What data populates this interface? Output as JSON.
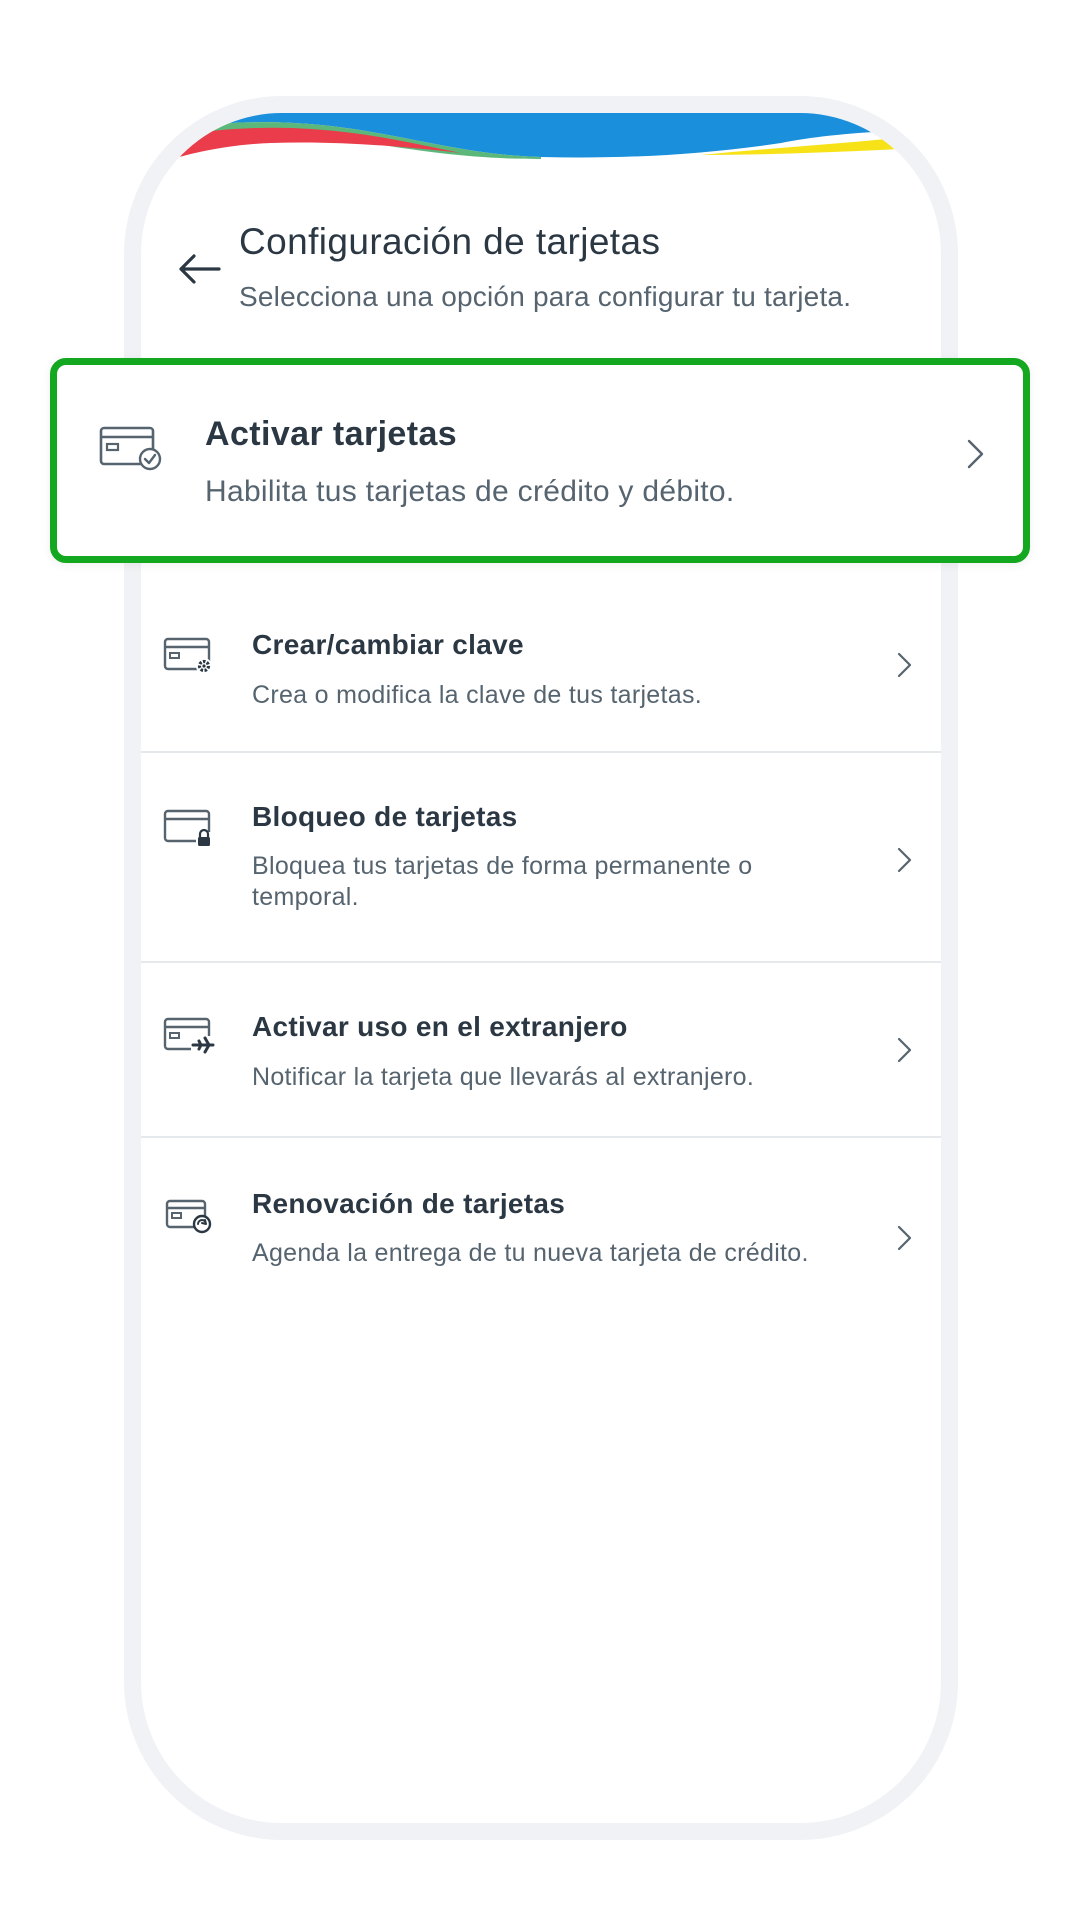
{
  "header": {
    "title": "Configuración de tarjetas",
    "subtitle": "Selecciona una opción para configurar tu tarjeta.",
    "back_icon": "arrow-left-icon"
  },
  "highlighted_option": {
    "label": "Activar tarjetas",
    "description": "Habilita tus tarjetas de crédito y débito.",
    "icon": "card-check-icon",
    "highlight_color": "#13a81f"
  },
  "options": [
    {
      "label": "Crear/cambiar clave",
      "description": "Crea o modifica la clave de tus tarjetas.",
      "icon": "card-gear-icon"
    },
    {
      "label": "Bloqueo de tarjetas",
      "description": "Bloquea tus tarjetas de forma permanente o temporal.",
      "icon": "card-lock-icon"
    },
    {
      "label": "Activar uso en el extranjero",
      "description": "Notificar la tarjeta que llevarás al extranjero.",
      "icon": "card-plane-icon"
    },
    {
      "label": "Renovación de tarjetas",
      "description": "Agenda la entrega de tu nueva tarjeta de crédito.",
      "icon": "card-renew-icon"
    }
  ],
  "colors": {
    "wave_red": "#ea3c4a",
    "wave_green": "#5cb87a",
    "wave_blue": "#1a8fdc",
    "wave_yellow": "#f6e217",
    "text_primary": "#2b3843",
    "text_secondary": "#56646f"
  }
}
